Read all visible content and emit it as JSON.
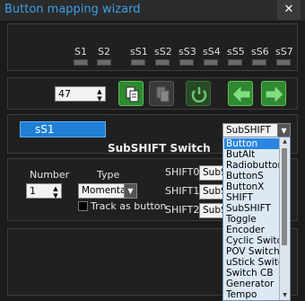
{
  "window": {
    "title": "Button mapping wizard",
    "close_label": "✕"
  },
  "slots": [
    "S1",
    "S2",
    "sS1",
    "sS2",
    "sS3",
    "sS4",
    "sS5",
    "sS6",
    "sS7"
  ],
  "nav": {
    "number_value": "47"
  },
  "current_button": {
    "name": "sS1",
    "switch_title": "SubSHIFT Switch",
    "type_selected": "SubSHIFT"
  },
  "left": {
    "number_label": "Number",
    "number_value": "1",
    "type_label": "Type",
    "type_value": "Momentary",
    "track_label": "Track as button"
  },
  "shifts": [
    {
      "label": "SHIFT0",
      "value": "SubSh"
    },
    {
      "label": "SHIFT1",
      "value": "SubSh"
    },
    {
      "label": "SHIFT2",
      "value": "SubSh"
    }
  ],
  "type_options": [
    "Button",
    "ButAlt",
    "Radiobutton",
    "ButtonS",
    "ButtonX",
    "SHIFT",
    "SubSHIFT",
    "Toggle",
    "Encoder",
    "Cyclic Switch",
    "POV Switch",
    "uStick Switch",
    "Switch CB",
    "Generator",
    "Tempo"
  ],
  "type_options_selected_index": 0,
  "colors": {
    "accent": "#3aa0e8",
    "selected_blue": "#2a86e0",
    "green_button": "#2f8a2f"
  }
}
